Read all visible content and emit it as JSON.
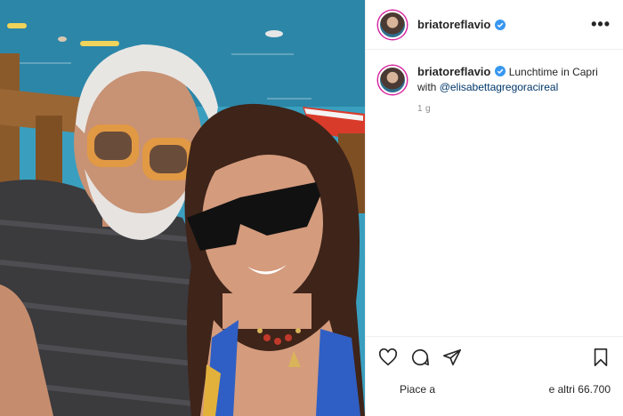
{
  "post": {
    "username": "briatoreflavio",
    "more_label": "•••",
    "caption": {
      "username": "briatoreflavio",
      "text": "Lunchtime in Capri with",
      "mention": "@elisabettagregoracireal"
    },
    "time_ago": "1 g",
    "likes": {
      "prefix": "Piace a",
      "suffix": "e altri 66.700"
    },
    "icons": {
      "verified": "verified-badge-icon",
      "like": "heart-icon",
      "comment": "comment-icon",
      "share": "paper-plane-icon",
      "save": "bookmark-icon",
      "more": "more-options-icon"
    },
    "colors": {
      "verified": "#3897f0",
      "mention": "#00376b",
      "muted": "#8e8e8e",
      "border": "#efefef"
    }
  }
}
